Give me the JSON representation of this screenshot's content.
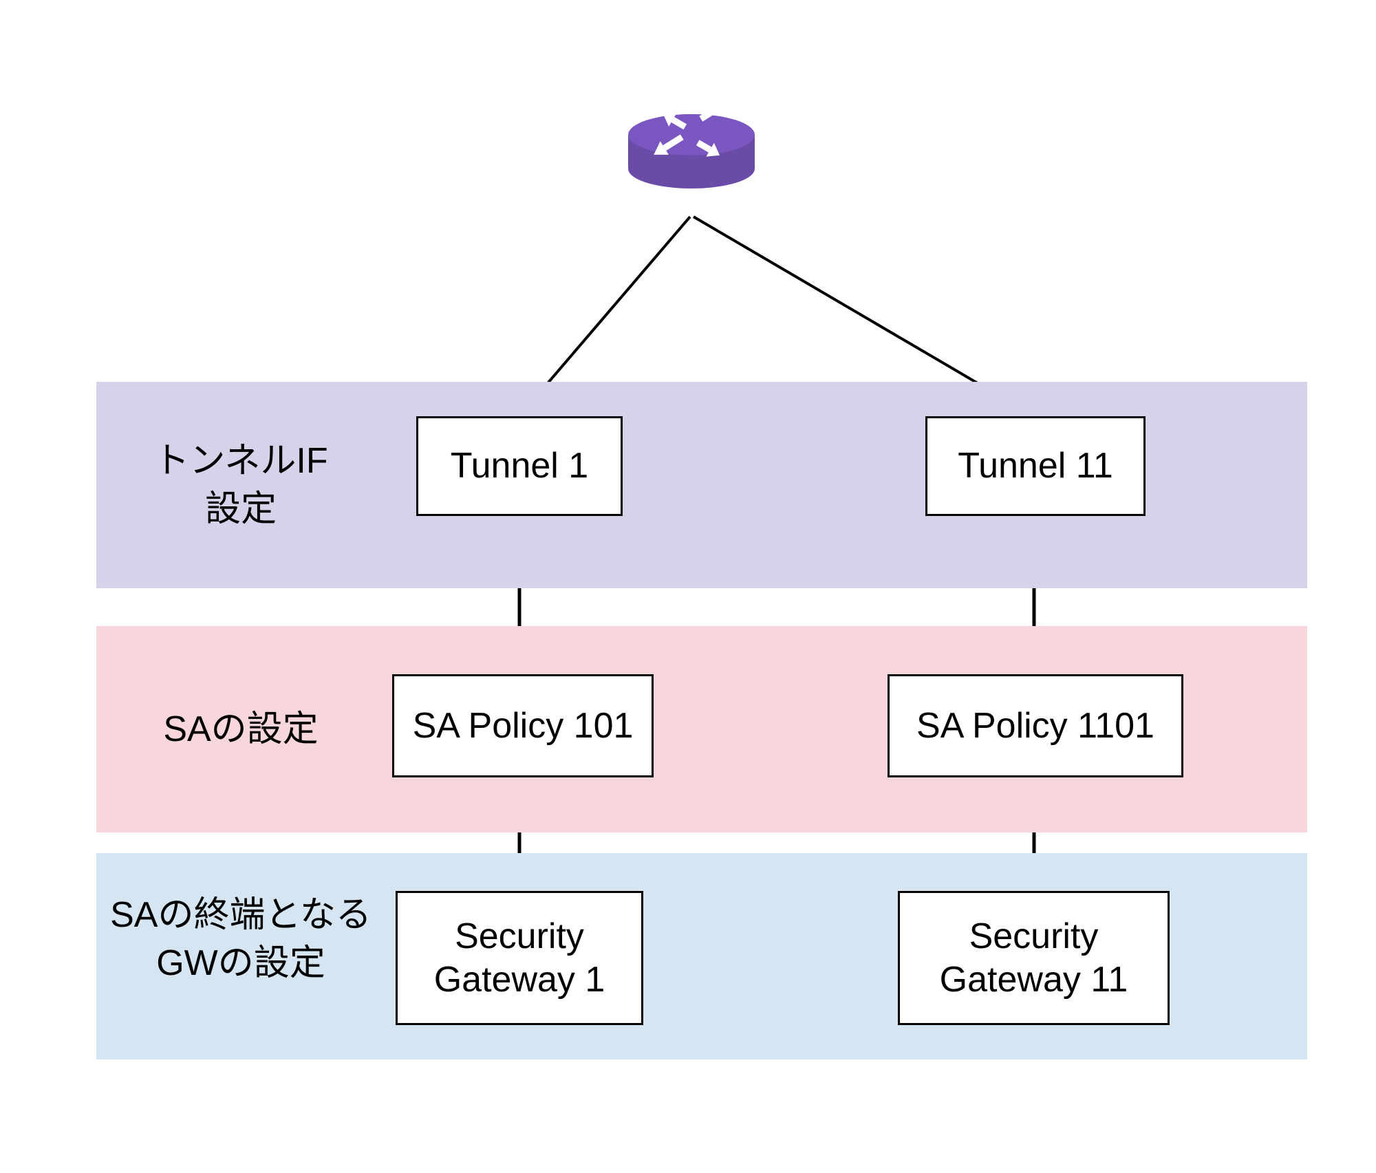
{
  "rows": {
    "tunnel_label": "トンネルIF\n設定",
    "sa_label": "SAの設定",
    "gw_label": "SAの終端となる\nGWの設定"
  },
  "nodes": {
    "tunnel_1": "Tunnel 1",
    "tunnel_11": "Tunnel 11",
    "sa_101": "SA Policy 101",
    "sa_1101": "SA Policy 1101",
    "gw_1": "Security\nGateway 1",
    "gw_11": "Security\nGateway 11"
  },
  "icon": {
    "name": "router-icon",
    "color": "#7a57c0"
  }
}
